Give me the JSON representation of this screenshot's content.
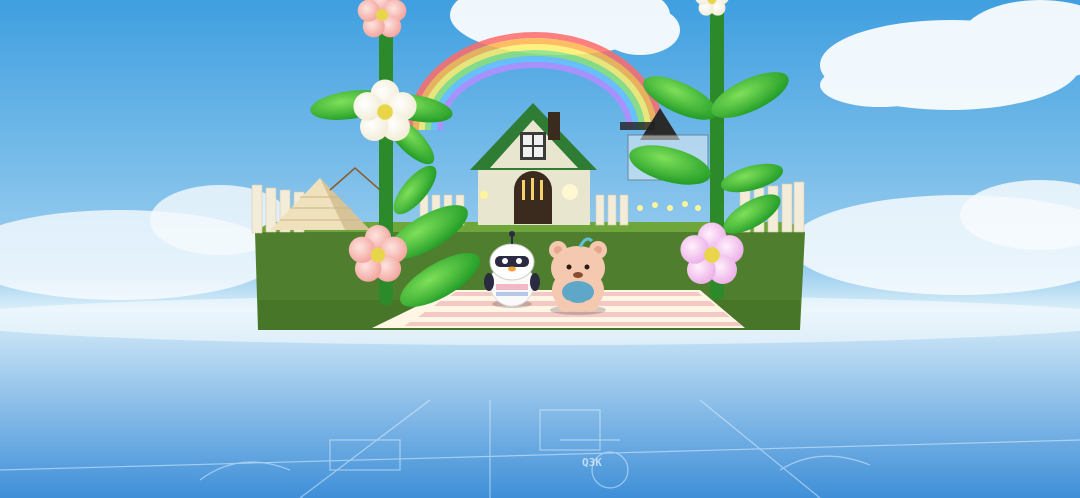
{
  "scene": {
    "floor_label": "Q3K"
  },
  "colors": {
    "sky_top": "#3f9fe0",
    "sky_bottom": "#cfe8f8",
    "cloud": "#ffffff",
    "grass_side": "#4f7f2e",
    "grass_top": "#6fa63c",
    "house_wall": "#e9e6cf",
    "house_roof": "#2f7d35",
    "door": "#3b2a1e",
    "leaf": "#3dbb2c",
    "stem": "#2c8a2a",
    "flower_pink": "#f6b7b0",
    "flower_lilac": "#f3c7ef",
    "flower_white": "#fffbee",
    "flower_center": "#e9d54a",
    "path_pink": "#f4c8c4",
    "path_cream": "#fff6e6",
    "penguin_body": "#ffffff",
    "penguin_mask": "#2a2a40",
    "bear_fur": "#f4c9b0",
    "bear_shirt": "#5ea7c9"
  },
  "characters": [
    {
      "icon": "penguin-astronaut-icon"
    },
    {
      "icon": "teddy-bear-icon"
    }
  ]
}
